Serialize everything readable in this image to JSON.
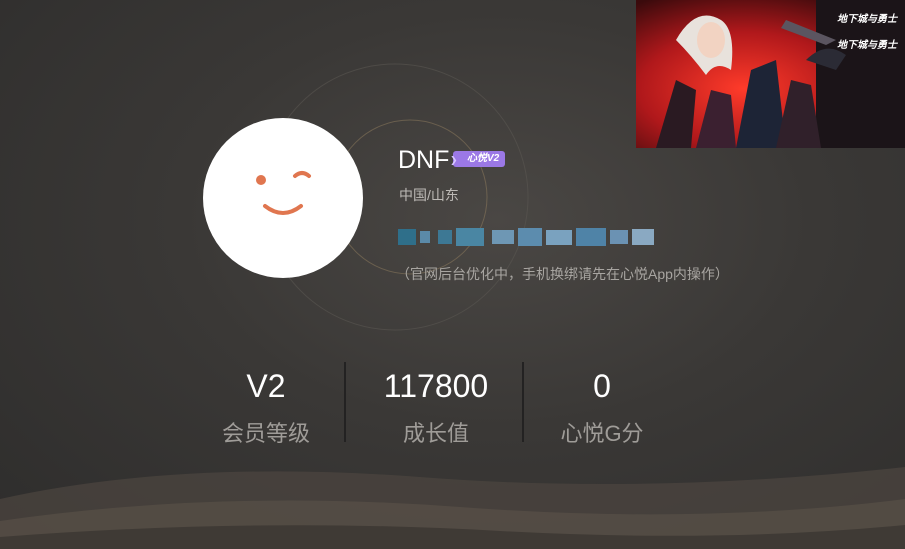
{
  "profile": {
    "username": "DNF",
    "vip_badge": "心悦V2",
    "location": "中国/山东",
    "notice": "（官网后台优化中，手机换绑请先在心悦App内操作）"
  },
  "stats": [
    {
      "value": "V2",
      "label": "会员等级"
    },
    {
      "value": "117800",
      "label": "成长值"
    },
    {
      "value": "0",
      "label": "心悦G分"
    }
  ],
  "banner": {
    "logo_text_1": "地下城与勇士",
    "logo_text_2": "地下城与勇士"
  },
  "colors": {
    "background": "#3a3836",
    "badge": "#9b78e6",
    "avatar_face": "#e0764f",
    "label": "#9f9c98"
  }
}
